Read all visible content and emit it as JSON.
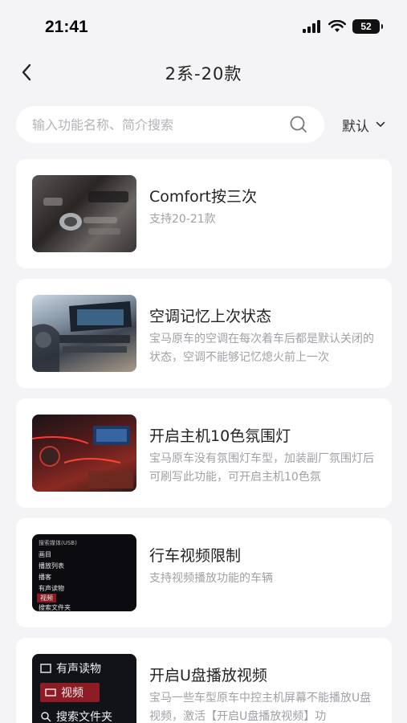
{
  "status_bar": {
    "time": "21:41",
    "battery": "52",
    "icons": [
      "signal-icon",
      "wifi-icon",
      "battery-icon"
    ]
  },
  "nav": {
    "title": "2系-20款",
    "back_icon": "chevron-left-icon"
  },
  "search": {
    "placeholder": "输入功能名称、简介搜索",
    "value": "",
    "icon": "search-icon"
  },
  "sort": {
    "label": "默认",
    "icon": "chevron-down-icon"
  },
  "features": [
    {
      "title": "Comfort按三次",
      "desc": "支持20-21款",
      "thumb": "center-console-photo"
    },
    {
      "title": "空调记忆上次状态",
      "desc": "宝马原车的空调在每次着车后都是默认关闭的状态，空调不能够记忆熄火前上一次",
      "thumb": "dashboard-photo"
    },
    {
      "title": "开启主机10色氛围灯",
      "desc": "宝马原车没有氛围灯车型，加装副厂氛围灯后可刷写此功能，可开启主机10色氛",
      "thumb": "ambient-light-photo"
    },
    {
      "title": "行车视频限制",
      "desc": "支持视频播放功能的车辆",
      "thumb": "media-menu-screenshot",
      "thumb_text": {
        "header": "搜索媒体(USB)",
        "items": [
          "画目",
          "播放列表",
          "播客",
          "有声读物",
          "视频",
          "搜索文件夹"
        ],
        "selected": "视频"
      }
    },
    {
      "title": "开启U盘播放视频",
      "desc": "宝马一些车型原车中控主机屏幕不能播放U盘视频，激活【开启U盘播放视频】功",
      "thumb": "media-menu-closeup",
      "thumb_text": {
        "items": [
          "有声读物",
          "视频",
          "搜索文件夹"
        ],
        "selected": "视频"
      }
    }
  ],
  "colors": {
    "background": "#f4f4f6",
    "card": "#ffffff",
    "title_text": "#222222",
    "desc_text": "#a0a0a6",
    "menu_highlight": "#8a1a22"
  }
}
